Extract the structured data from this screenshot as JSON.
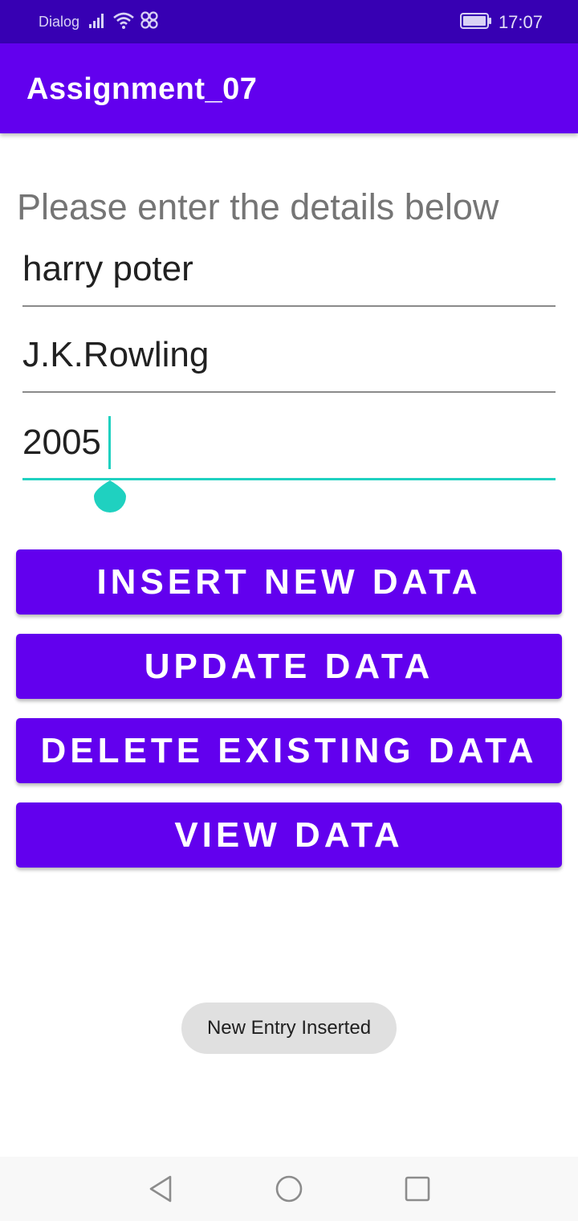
{
  "status_bar": {
    "carrier": "Dialog",
    "time": "17:07",
    "icons": [
      "signal-icon",
      "wifi-icon",
      "link-icon",
      "battery-icon"
    ]
  },
  "app_bar": {
    "title": "Assignment_07"
  },
  "form": {
    "prompt": "Please enter the details below",
    "title_value": "harry poter",
    "author_value": "J.K.Rowling",
    "year_value": "2005"
  },
  "buttons": {
    "insert": "INSERT NEW DATA",
    "update": "UPDATE DATA",
    "delete": "DELETE EXISTING DATA",
    "view": "VIEW DATA"
  },
  "toast": {
    "message": "New Entry Inserted"
  },
  "nav_bar": {
    "icons": [
      "back-icon",
      "home-icon",
      "recents-icon"
    ]
  },
  "colors": {
    "status_bar": "#3700b3",
    "primary": "#6200ee",
    "accent": "#1fd1c0",
    "toast_bg": "#e0e0e0"
  }
}
